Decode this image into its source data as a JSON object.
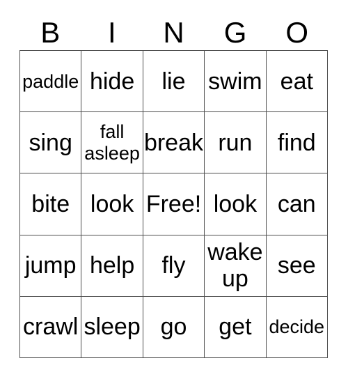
{
  "card": {
    "title": "BINGO",
    "headers": [
      "B",
      "I",
      "N",
      "G",
      "O"
    ],
    "free_space_label": "Free!",
    "colors": {
      "background": "#ffffff",
      "grid_line": "#4d4d4d",
      "text": "#000000"
    },
    "rows": [
      [
        {
          "label": "paddle",
          "size": "small"
        },
        {
          "label": "hide",
          "size": "normal"
        },
        {
          "label": "lie",
          "size": "normal"
        },
        {
          "label": "swim",
          "size": "normal"
        },
        {
          "label": "eat",
          "size": "normal"
        }
      ],
      [
        {
          "label": "sing",
          "size": "normal"
        },
        {
          "label": "fall asleep",
          "size": "wrap-small"
        },
        {
          "label": "break",
          "size": "normal"
        },
        {
          "label": "run",
          "size": "normal"
        },
        {
          "label": "find",
          "size": "normal"
        }
      ],
      [
        {
          "label": "bite",
          "size": "normal"
        },
        {
          "label": "look",
          "size": "normal"
        },
        {
          "label": "Free!",
          "size": "normal"
        },
        {
          "label": "look",
          "size": "normal"
        },
        {
          "label": "can",
          "size": "normal"
        }
      ],
      [
        {
          "label": "jump",
          "size": "normal"
        },
        {
          "label": "help",
          "size": "normal"
        },
        {
          "label": "fly",
          "size": "normal"
        },
        {
          "label": "wake up",
          "size": "wrap"
        },
        {
          "label": "see",
          "size": "normal"
        }
      ],
      [
        {
          "label": "crawl",
          "size": "normal"
        },
        {
          "label": "sleep",
          "size": "normal"
        },
        {
          "label": "go",
          "size": "normal"
        },
        {
          "label": "get",
          "size": "normal"
        },
        {
          "label": "decide",
          "size": "small"
        }
      ]
    ]
  }
}
